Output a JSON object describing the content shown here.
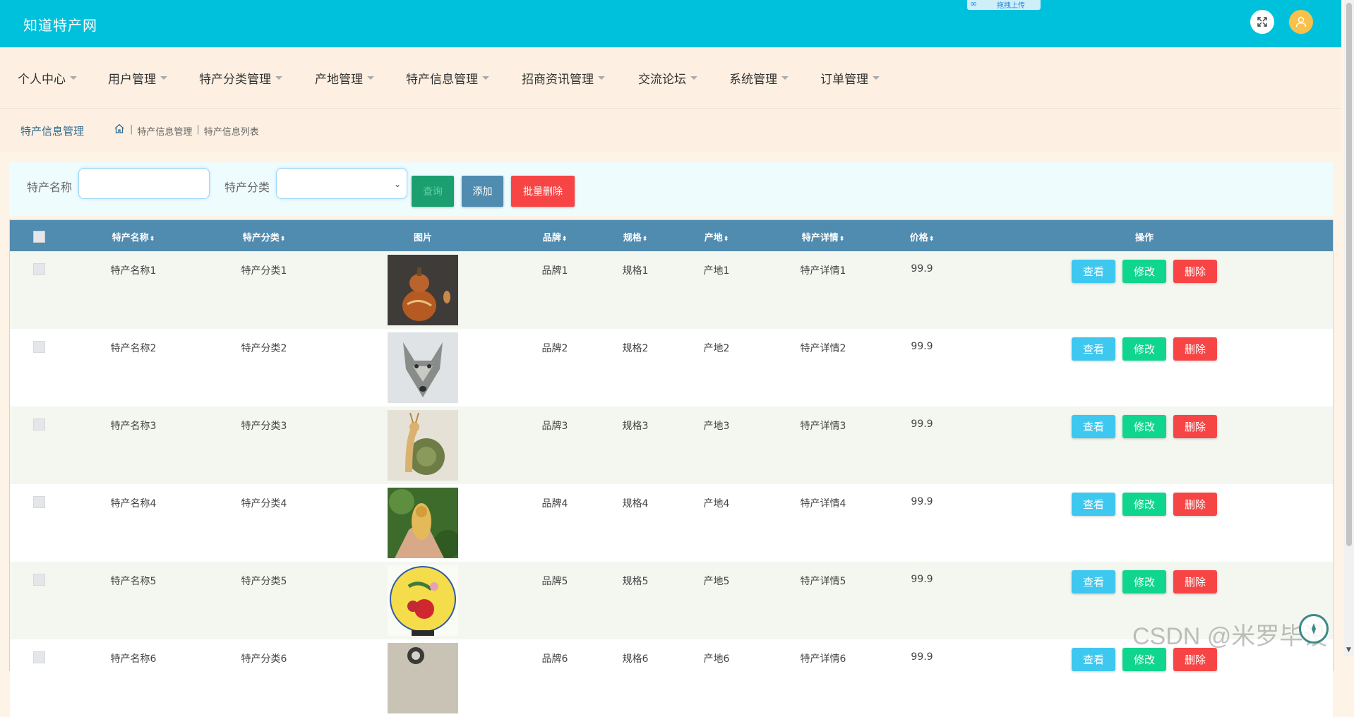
{
  "header": {
    "brand": "知道特产网",
    "upload_chip_label": "拖拽上传",
    "fullscreen_icon": "expand-icon",
    "user_icon": "user-icon"
  },
  "nav": {
    "items": [
      {
        "label": "个人中心"
      },
      {
        "label": "用户管理"
      },
      {
        "label": "特产分类管理"
      },
      {
        "label": "产地管理"
      },
      {
        "label": "特产信息管理"
      },
      {
        "label": "招商资讯管理"
      },
      {
        "label": "交流论坛"
      },
      {
        "label": "系统管理"
      },
      {
        "label": "订单管理"
      }
    ]
  },
  "breadcrumb": {
    "title": "特产信息管理",
    "trail": [
      "特产信息管理",
      "特产信息列表"
    ]
  },
  "filters": {
    "name_label": "特产名称",
    "name_value": "",
    "category_label": "特产分类",
    "category_value": "",
    "search_label": "查询",
    "add_label": "添加",
    "bulk_delete_label": "批量删除"
  },
  "table": {
    "columns": [
      "特产名称",
      "特产分类",
      "图片",
      "品牌",
      "规格",
      "产地",
      "特产详情",
      "价格",
      "操作"
    ],
    "sort_glyph": "⬍",
    "actions": {
      "view": "查看",
      "edit": "修改",
      "delete": "删除"
    },
    "rows": [
      {
        "name": "特产名称1",
        "category": "特产分类1",
        "image": "gourd-craft-image",
        "brand": "品牌1",
        "spec": "规格1",
        "origin": "产地1",
        "detail": "特产详情1",
        "price": "99.9"
      },
      {
        "name": "特产名称2",
        "category": "特产分类2",
        "image": "wolf-head-image",
        "brand": "品牌2",
        "spec": "规格2",
        "origin": "产地2",
        "detail": "特产详情2",
        "price": "99.9"
      },
      {
        "name": "特产名称3",
        "category": "特产分类3",
        "image": "jade-snail-image",
        "brand": "品牌3",
        "spec": "规格3",
        "origin": "产地3",
        "detail": "特产详情3",
        "price": "99.9"
      },
      {
        "name": "特产名称4",
        "category": "特产分类4",
        "image": "carved-figurine-image",
        "brand": "品牌4",
        "spec": "规格4",
        "origin": "产地4",
        "detail": "特产详情4",
        "price": "99.9"
      },
      {
        "name": "特产名称5",
        "category": "特产分类5",
        "image": "peony-plate-image",
        "brand": "品牌5",
        "spec": "规格5",
        "origin": "产地5",
        "detail": "特产详情5",
        "price": "99.9"
      },
      {
        "name": "特产名称6",
        "category": "特产分类6",
        "image": "partial-image",
        "brand": "品牌6",
        "spec": "规格6",
        "origin": "产地6",
        "detail": "特产详情6",
        "price": "99.9"
      }
    ]
  },
  "watermark": "CSDN @米罗毕设",
  "colors": {
    "header": "#00c1dc",
    "table_head": "#508bb0",
    "view": "#3ec8ef",
    "edit": "#10d58f",
    "delete": "#f74545"
  }
}
